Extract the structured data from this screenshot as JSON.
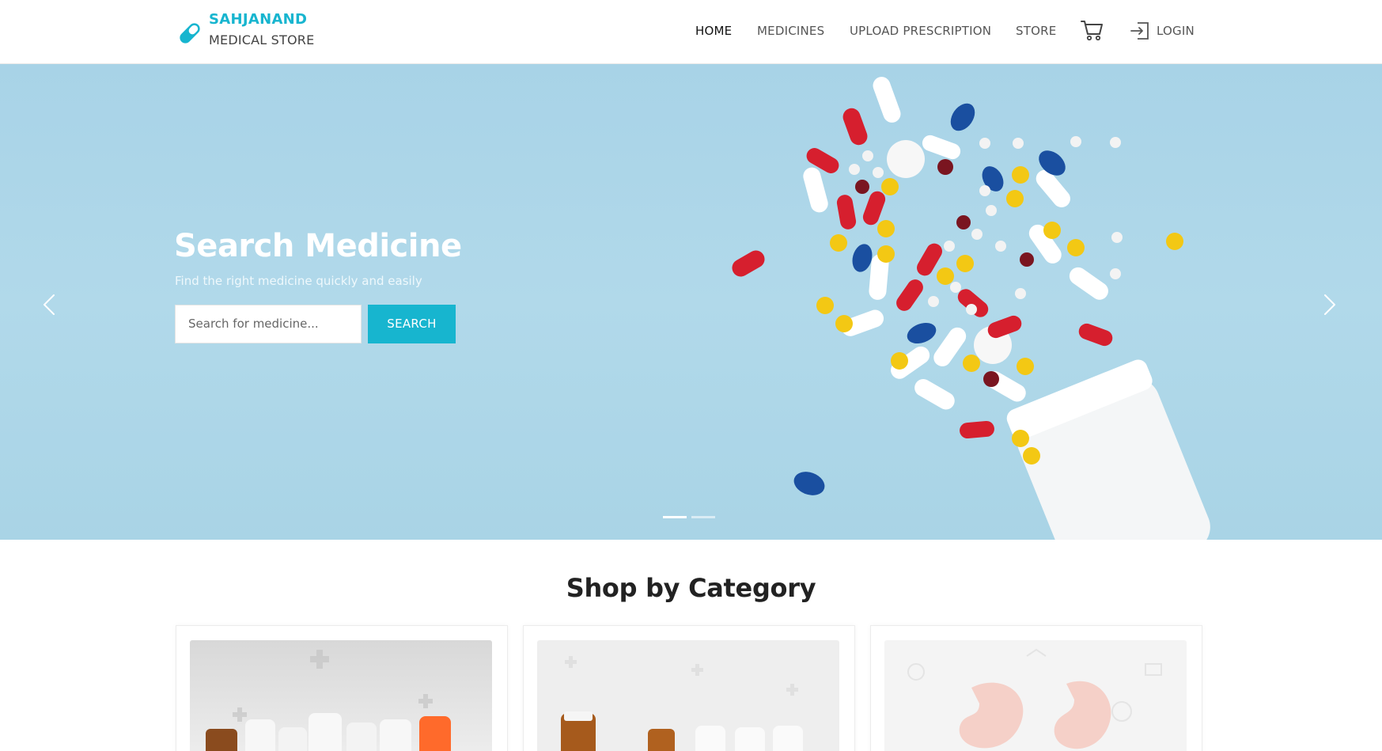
{
  "brand": {
    "name": "SAHJANAND",
    "subtitle": "MEDICAL STORE",
    "accent_color": "#17b5cf",
    "icon": "capsule-icon"
  },
  "nav": {
    "items": [
      {
        "label": "HOME",
        "active": true
      },
      {
        "label": "MEDICINES",
        "active": false
      },
      {
        "label": "UPLOAD PRESCRIPTION",
        "active": false
      },
      {
        "label": "STORE",
        "active": false
      }
    ],
    "cart_icon": "cart-icon",
    "login_icon": "login-icon",
    "login_label": "LOGIN"
  },
  "hero": {
    "title": "Search Medicine",
    "subtitle": "Find the right medicine quickly and easily",
    "search_placeholder": "Search for medicine...",
    "search_button": "SEARCH",
    "prev_icon": "chevron-left-icon",
    "next_icon": "chevron-right-icon",
    "slides": 2,
    "active_slide": 1
  },
  "categories": {
    "title": "Shop by Category",
    "cards": [
      {
        "image": "medicine-bottles-image"
      },
      {
        "image": "medicine-bottles-image"
      },
      {
        "image": "digestive-health-image"
      }
    ]
  }
}
